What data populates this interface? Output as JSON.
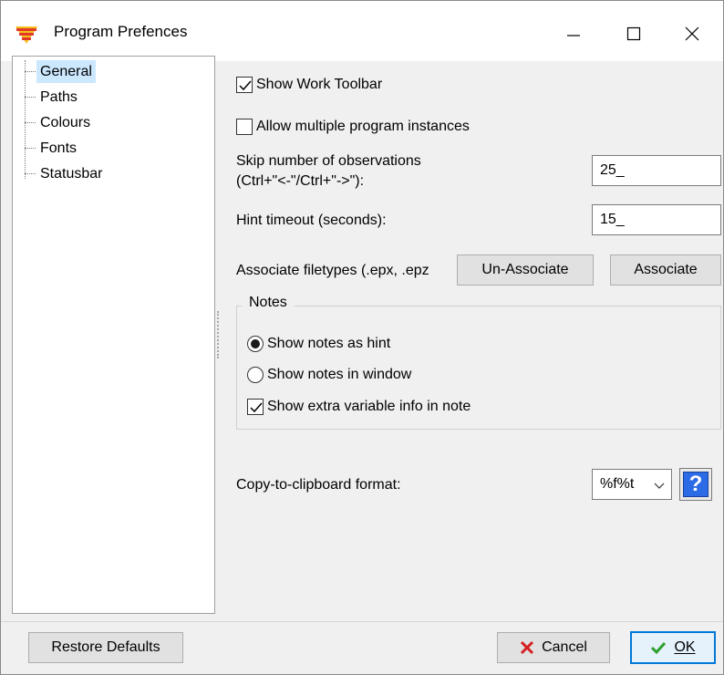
{
  "window": {
    "title": "Program Prefences"
  },
  "tree": {
    "items": [
      {
        "label": "General",
        "selected": true
      },
      {
        "label": "Paths"
      },
      {
        "label": "Colours"
      },
      {
        "label": "Fonts"
      },
      {
        "label": "Statusbar"
      }
    ]
  },
  "general": {
    "show_work_toolbar": {
      "label": "Show Work Toolbar",
      "checked": true
    },
    "allow_multiple_instances": {
      "label": "Allow multiple program instances",
      "checked": false
    },
    "skip_observations": {
      "label_line1": "Skip number of observations",
      "label_line2": "(Ctrl+\"<-\"/Ctrl+\"->\"):",
      "value": "25_"
    },
    "hint_timeout": {
      "label": "Hint timeout (seconds):",
      "value": "15_"
    },
    "associate": {
      "label": "Associate filetypes (.epx, .epz",
      "unassociate_button": "Un-Associate",
      "associate_button": "Associate"
    },
    "notes": {
      "group_title": "Notes",
      "show_as_hint": {
        "label": "Show notes as hint",
        "selected": true
      },
      "show_in_window": {
        "label": "Show notes in window",
        "selected": false
      },
      "show_extra_info": {
        "label": "Show extra variable info in note",
        "checked": true
      }
    },
    "clipboard": {
      "label": "Copy-to-clipboard format:",
      "value": "%f%t",
      "help": "?"
    }
  },
  "buttons": {
    "restore_defaults": "Restore Defaults",
    "cancel": "Cancel",
    "ok": "OK"
  },
  "colors": {
    "selection": "#cce8ff",
    "accent": "#0078d7",
    "cancel_icon": "#d42020",
    "ok_icon": "#2ea02e"
  }
}
